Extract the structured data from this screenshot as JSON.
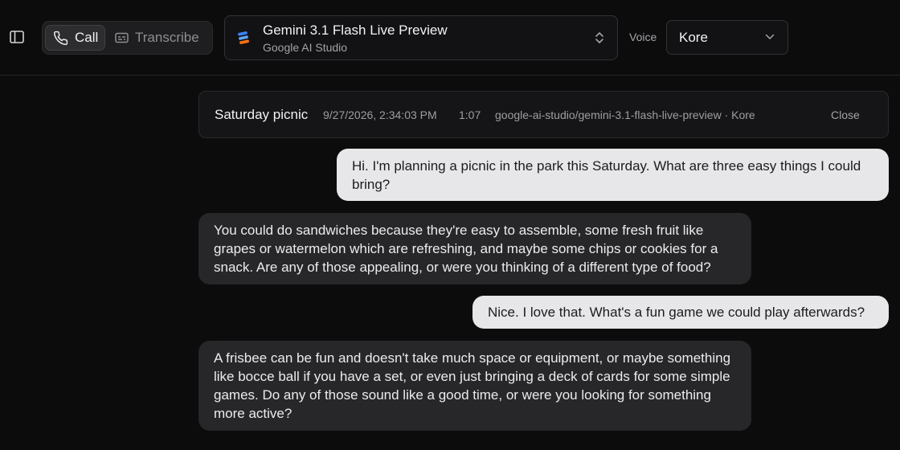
{
  "header": {
    "modes": [
      {
        "label": "Call",
        "icon": "phone-icon",
        "active": true
      },
      {
        "label": "Transcribe",
        "icon": "captions-icon",
        "active": false
      }
    ],
    "model": {
      "name": "Gemini 3.1 Flash Live Preview",
      "provider": "Google AI Studio"
    },
    "voice": {
      "label": "Voice",
      "value": "Kore"
    }
  },
  "session": {
    "title": "Saturday picnic",
    "date": "9/27/2026, 2:34:03 PM",
    "duration": "1:07",
    "model_voice": "google-ai-studio/gemini-3.1-flash-live-preview · Kore",
    "close_label": "Close"
  },
  "messages": [
    {
      "role": "user",
      "text": "Hi. I'm planning a picnic in the park this Saturday. What are three easy things I could bring?"
    },
    {
      "role": "model",
      "text": "You could do sandwiches because they're easy to assemble, some fresh fruit like grapes or watermelon which are refreshing, and maybe some chips or cookies for a snack. Are any of those appealing, or were you thinking of a different type of food?"
    },
    {
      "role": "user",
      "text": "Nice. I love that. What's a fun game we could play afterwards?"
    },
    {
      "role": "model",
      "text": "A frisbee can be fun and doesn't take much space or equipment, or maybe something like bocce ball if you have a set, or even just bringing a deck of cards for some simple games. Do any of those sound like a good time, or were you looking for something more active?"
    }
  ],
  "colors": {
    "background": "#0c0c0d",
    "user_bubble": "#e7e7e9",
    "model_bubble": "#27272a",
    "logo_blue": "#3b82f6",
    "logo_orange": "#f97316"
  }
}
